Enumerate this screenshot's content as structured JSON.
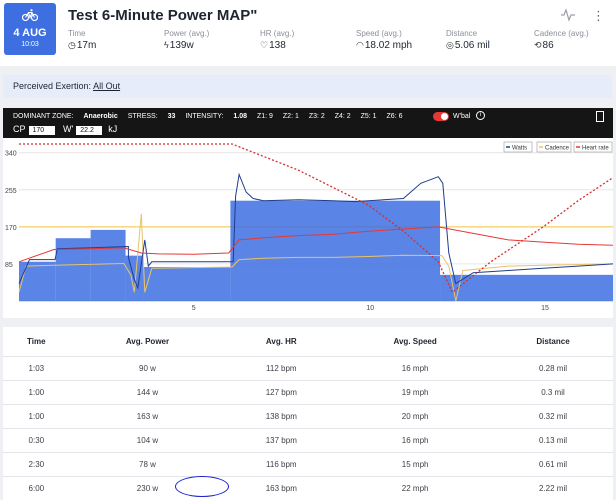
{
  "activity": {
    "date_day": "4 AUG",
    "date_time": "10:03",
    "title": "Test 6-Minute Power MAP\"",
    "icon": "bike-icon"
  },
  "stats": [
    {
      "label": "Time",
      "value": "17m",
      "icon": "clock-icon"
    },
    {
      "label": "Power (avg.)",
      "value": "139w",
      "icon": "bolt-icon"
    },
    {
      "label": "HR (avg.)",
      "value": "138",
      "icon": "heart-icon"
    },
    {
      "label": "Speed (avg.)",
      "value": "18.02 mph",
      "icon": "speedometer-icon"
    },
    {
      "label": "Distance",
      "value": "5.06 mil",
      "icon": "distance-icon"
    },
    {
      "label": "Cadence (avg.)",
      "value": "86",
      "icon": "cadence-icon"
    }
  ],
  "exertion": {
    "label": "Perceived Exertion:",
    "value": "All Out"
  },
  "zone_bar": {
    "dominant_label": "DOMINANT ZONE:",
    "dominant_value": "Anaerobic",
    "stress_label": "STRESS:",
    "stress_value": "33",
    "intensity_label": "INTENSITY:",
    "intensity_value": "1.08",
    "zones": [
      "Z1: 9",
      "Z2: 1",
      "Z3: 2",
      "Z4: 2",
      "Z5: 1",
      "Z6: 6"
    ],
    "wbal_label": "W'bal",
    "cp_label": "CP",
    "cp_value": "170",
    "w_label": "W'",
    "w_value": "22.2",
    "w_unit": "kJ"
  },
  "chart_data": {
    "type": "line",
    "title": "",
    "xlabel": "",
    "ylabel": "",
    "xlim": [
      0,
      17
    ],
    "ylim": [
      0,
      360
    ],
    "x_ticks": [
      5,
      10,
      15
    ],
    "y_ticks": [
      85,
      170,
      255,
      340
    ],
    "legend": [
      "Watts",
      "Cadence",
      "Heart rate"
    ],
    "legend_position": "top-right",
    "colors": {
      "watts": "#1f3d8f",
      "watts_fill": "#5b86e5",
      "zone_block": "#3d6fe0",
      "cadence": "#e8c46a",
      "heart_rate": "#e53935",
      "wbal": "#d32f2f"
    },
    "series": [
      {
        "name": "Watts",
        "points": [
          [
            0,
            40
          ],
          [
            0.3,
            95
          ],
          [
            1.03,
            95
          ],
          [
            1.1,
            120
          ],
          [
            2.1,
            122
          ],
          [
            3.13,
            125
          ],
          [
            3.13,
            100
          ],
          [
            3.3,
            50
          ],
          [
            3.4,
            30
          ],
          [
            3.6,
            140
          ],
          [
            3.7,
            80
          ],
          [
            3.8,
            90
          ],
          [
            6.13,
            90
          ],
          [
            6.2,
            240
          ],
          [
            6.3,
            290
          ],
          [
            6.5,
            250
          ],
          [
            6.7,
            235
          ],
          [
            7,
            230
          ],
          [
            8,
            232
          ],
          [
            9,
            230
          ],
          [
            9.6,
            228
          ],
          [
            10,
            230
          ],
          [
            11,
            235
          ],
          [
            11.5,
            270
          ],
          [
            12,
            285
          ],
          [
            12.13,
            270
          ],
          [
            12.3,
            110
          ],
          [
            12.5,
            40
          ],
          [
            13,
            65
          ],
          [
            14,
            70
          ],
          [
            15,
            75
          ],
          [
            16,
            80
          ],
          [
            17,
            85
          ]
        ]
      },
      {
        "name": "Cadence",
        "points": [
          [
            0,
            20
          ],
          [
            0.2,
            80
          ],
          [
            1,
            82
          ],
          [
            2,
            84
          ],
          [
            3,
            86
          ],
          [
            3.2,
            60
          ],
          [
            3.3,
            20
          ],
          [
            3.5,
            200
          ],
          [
            3.6,
            20
          ],
          [
            3.8,
            75
          ],
          [
            6.1,
            78
          ],
          [
            6.3,
            95
          ],
          [
            7,
            98
          ],
          [
            8,
            100
          ],
          [
            9,
            100
          ],
          [
            10,
            102
          ],
          [
            11,
            105
          ],
          [
            12.1,
            104
          ],
          [
            12.3,
            80
          ],
          [
            12.5,
            0
          ],
          [
            12.7,
            70
          ],
          [
            14,
            80
          ],
          [
            15,
            82
          ],
          [
            17,
            85
          ]
        ]
      },
      {
        "name": "Heart rate",
        "points": [
          [
            0,
            90
          ],
          [
            1,
            118
          ],
          [
            2,
            120
          ],
          [
            3,
            122
          ],
          [
            3.5,
            110
          ],
          [
            4,
            108
          ],
          [
            5,
            107
          ],
          [
            6,
            110
          ],
          [
            6.3,
            140
          ],
          [
            7,
            145
          ],
          [
            8,
            150
          ],
          [
            9,
            153
          ],
          [
            10,
            160
          ],
          [
            11,
            165
          ],
          [
            12,
            170
          ],
          [
            13,
            155
          ],
          [
            14,
            140
          ],
          [
            15,
            135
          ],
          [
            16,
            130
          ],
          [
            17,
            128
          ]
        ]
      },
      {
        "name": "W'bal",
        "points": [
          [
            0,
            360
          ],
          [
            6.1,
            360
          ],
          [
            8,
            300
          ],
          [
            10,
            220
          ],
          [
            11,
            160
          ],
          [
            12,
            90
          ],
          [
            12.4,
            20
          ],
          [
            13.5,
            90
          ],
          [
            15,
            170
          ],
          [
            16,
            230
          ],
          [
            17,
            283
          ]
        ]
      }
    ],
    "intervals": [
      {
        "start": 0,
        "end": 1.05,
        "avg_power": 90
      },
      {
        "start": 1.05,
        "end": 2.05,
        "avg_power": 144
      },
      {
        "start": 2.05,
        "end": 3.05,
        "avg_power": 163
      },
      {
        "start": 3.05,
        "end": 3.55,
        "avg_power": 104
      },
      {
        "start": 3.55,
        "end": 6.05,
        "avg_power": 78
      },
      {
        "start": 6.05,
        "end": 12.05,
        "avg_power": 230
      }
    ]
  },
  "table": {
    "headers": [
      "Time",
      "Avg. Power",
      "Avg. HR",
      "Avg. Speed",
      "Distance"
    ],
    "rows": [
      [
        "1:03",
        "90 w",
        "112 bpm",
        "16 mph",
        "0.28 mil"
      ],
      [
        "1:00",
        "144 w",
        "127 bpm",
        "19 mph",
        "0.3 mil"
      ],
      [
        "1:00",
        "163 w",
        "138 bpm",
        "20 mph",
        "0.32 mil"
      ],
      [
        "0:30",
        "104 w",
        "137 bpm",
        "16 mph",
        "0.13 mil"
      ],
      [
        "2:30",
        "78 w",
        "116 bpm",
        "15 mph",
        "0.61 mil"
      ],
      [
        "6:00",
        "230 w",
        "163 bpm",
        "22 mph",
        "2.22 mil"
      ]
    ]
  }
}
